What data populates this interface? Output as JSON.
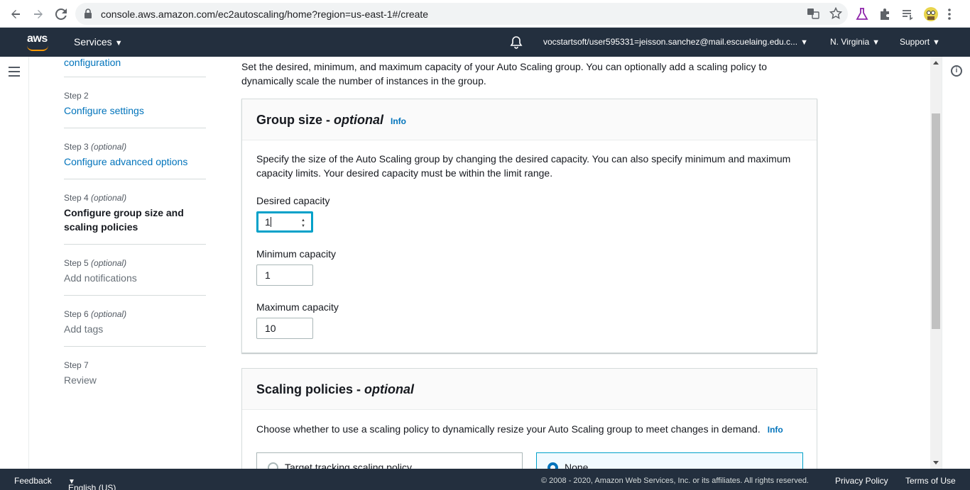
{
  "browser": {
    "url": "console.aws.amazon.com/ec2autoscaling/home?region=us-east-1#/create"
  },
  "aws_nav": {
    "logo_text": "aws",
    "services_label": "Services",
    "account_label": "vocstartsoft/user595331=jeisson.sanchez@mail.escuelaing.edu.c...",
    "region_label": "N. Virginia",
    "support_label": "Support"
  },
  "steps": [
    {
      "num": "",
      "optional": "",
      "title": "configuration",
      "state": "link"
    },
    {
      "num": "Step 2",
      "optional": "",
      "title": "Configure settings",
      "state": "link"
    },
    {
      "num": "Step 3",
      "optional": "(optional)",
      "title": "Configure advanced options",
      "state": "link"
    },
    {
      "num": "Step 4",
      "optional": "(optional)",
      "title": "Configure group size and scaling policies",
      "state": "current"
    },
    {
      "num": "Step 5",
      "optional": "(optional)",
      "title": "Add notifications",
      "state": "disabled"
    },
    {
      "num": "Step 6",
      "optional": "(optional)",
      "title": "Add tags",
      "state": "disabled"
    },
    {
      "num": "Step 7",
      "optional": "",
      "title": "Review",
      "state": "disabled"
    }
  ],
  "main": {
    "intro": "Set the desired, minimum, and maximum capacity of your Auto Scaling group. You can optionally add a scaling policy to dynamically scale the number of instances in the group.",
    "group_size": {
      "title_main": "Group size - ",
      "title_italic": "optional",
      "info_label": "Info",
      "description": "Specify the size of the Auto Scaling group by changing the desired capacity. You can also specify minimum and maximum capacity limits. Your desired capacity must be within the limit range.",
      "desired_label": "Desired capacity",
      "desired_value": "1",
      "min_label": "Minimum capacity",
      "min_value": "1",
      "max_label": "Maximum capacity",
      "max_value": "10"
    },
    "scaling_policies": {
      "title_main": "Scaling policies - ",
      "title_italic": "optional",
      "description": "Choose whether to use a scaling policy to dynamically resize your Auto Scaling group to meet changes in demand.",
      "info_label": "Info",
      "option_target": "Target tracking scaling policy",
      "option_none": "None",
      "selected": "None"
    }
  },
  "footer": {
    "feedback": "Feedback",
    "language": "English (US)",
    "copyright": "© 2008 - 2020, Amazon Web Services, Inc. or its affiliates. All rights reserved.",
    "privacy": "Privacy Policy",
    "terms": "Terms of Use"
  }
}
